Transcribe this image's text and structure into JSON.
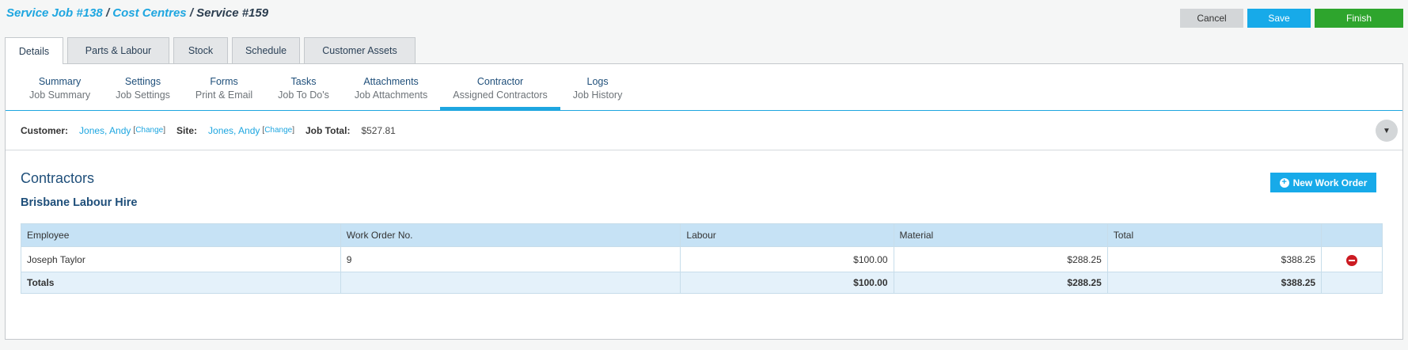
{
  "breadcrumb": {
    "job": "Service Job #138",
    "section": "Cost Centres",
    "current": "Service #159",
    "separator": "/"
  },
  "actions": {
    "cancel": "Cancel",
    "save": "Save",
    "finish": "Finish"
  },
  "main_tabs": [
    {
      "label": "Details",
      "active": true
    },
    {
      "label": "Parts & Labour"
    },
    {
      "label": "Stock"
    },
    {
      "label": "Schedule"
    },
    {
      "label": "Customer Assets"
    }
  ],
  "sub_tabs": [
    {
      "title": "Summary",
      "subtitle": "Job Summary"
    },
    {
      "title": "Settings",
      "subtitle": "Job Settings"
    },
    {
      "title": "Forms",
      "subtitle": "Print & Email"
    },
    {
      "title": "Tasks",
      "subtitle": "Job To Do's"
    },
    {
      "title": "Attachments",
      "subtitle": "Job Attachments"
    },
    {
      "title": "Contractor",
      "subtitle": "Assigned Contractors",
      "active": true
    },
    {
      "title": "Logs",
      "subtitle": "Job History"
    }
  ],
  "info": {
    "customer_label": "Customer:",
    "customer_value": "Jones, Andy",
    "site_label": "Site:",
    "site_value": "Jones, Andy",
    "change_label": "Change",
    "job_total_label": "Job Total:",
    "job_total_value": "$527.81"
  },
  "contractors": {
    "title": "Contractors",
    "company": "Brisbane Labour Hire",
    "new_work_order": "New Work Order",
    "columns": [
      "Employee",
      "Work Order No.",
      "Labour",
      "Material",
      "Total"
    ],
    "rows": [
      {
        "employee": "Joseph Taylor",
        "work_order": "9",
        "labour": "$100.00",
        "material": "$288.25",
        "total": "$388.25"
      }
    ],
    "totals": {
      "label": "Totals",
      "labour": "$100.00",
      "material": "$288.25",
      "total": "$388.25"
    }
  },
  "colors": {
    "accent": "#1ea6e0",
    "save": "#17aae9",
    "finish": "#2ea52d",
    "remove": "#cc1b22"
  }
}
